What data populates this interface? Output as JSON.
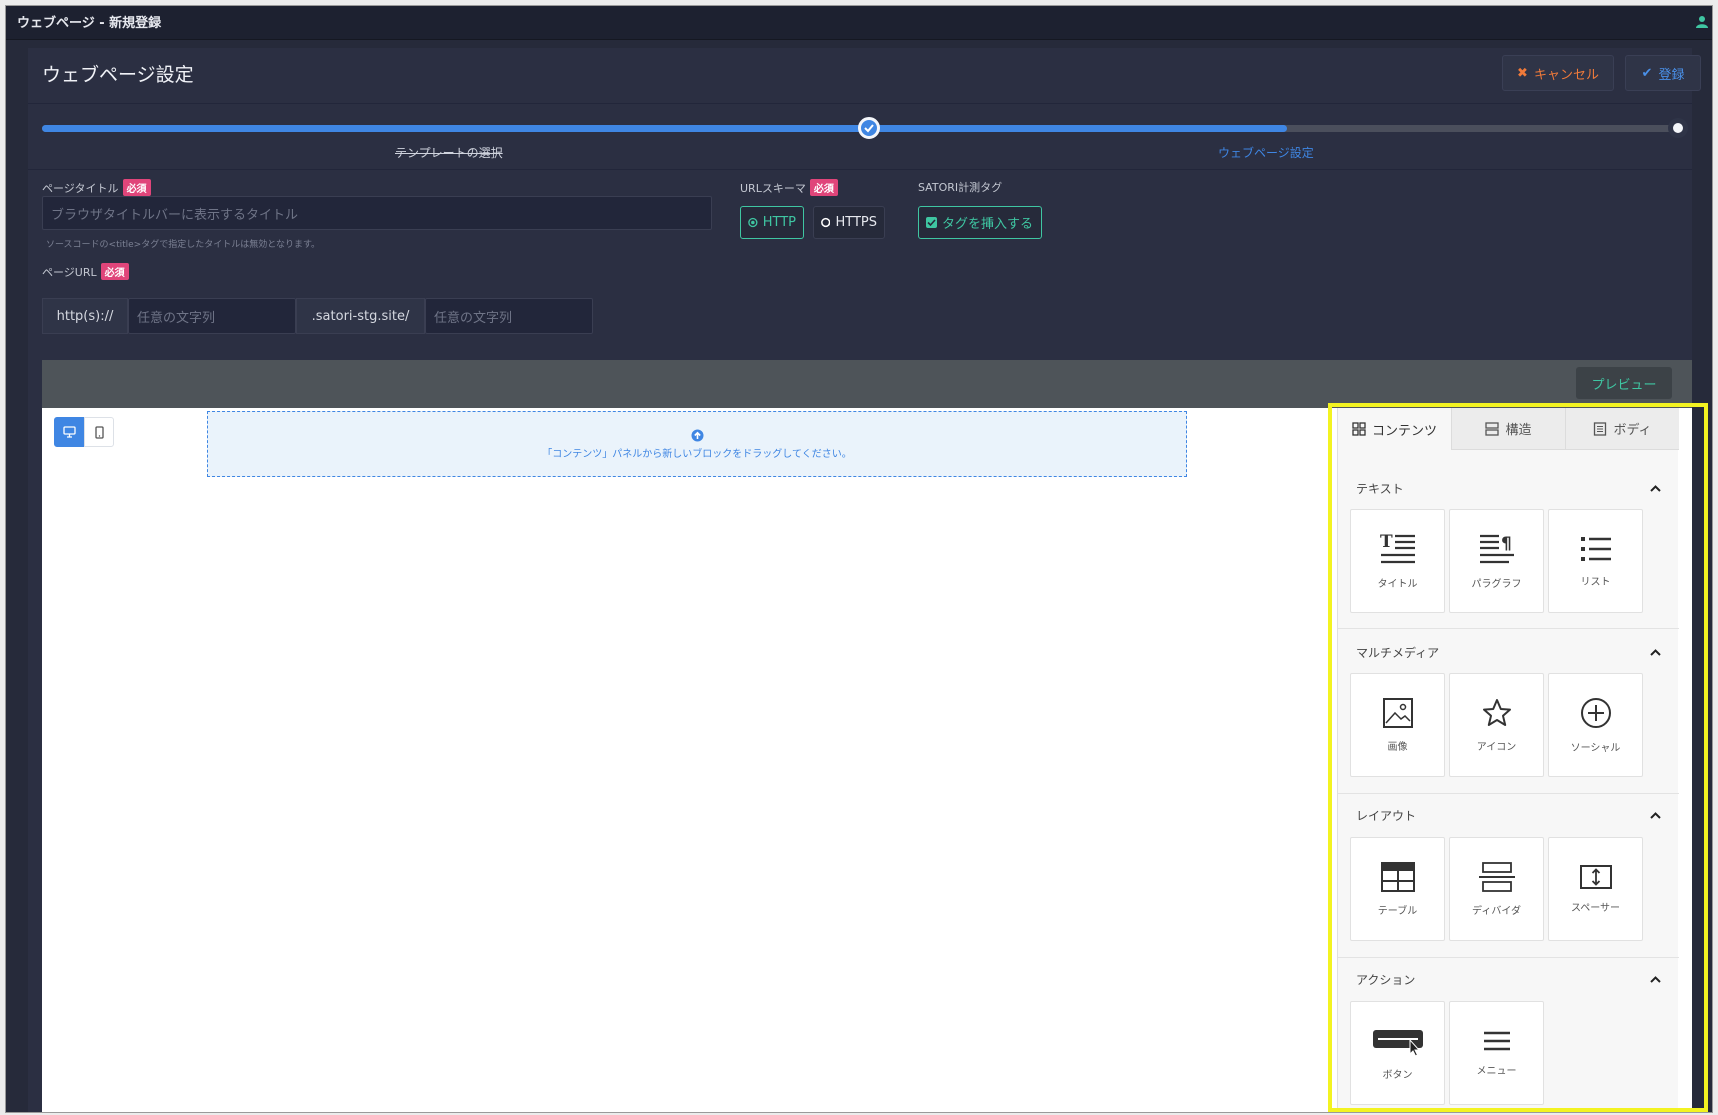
{
  "window": {
    "title": "ウェブページ - 新規登録"
  },
  "header": {
    "title": "ウェブページ設定",
    "cancel_label": "キャンセル",
    "register_label": "登録"
  },
  "progress": {
    "percent": 76,
    "steps": [
      {
        "label": "テンプレートの選択",
        "status": "completed"
      },
      {
        "label": "ウェブページ設定",
        "status": "current"
      }
    ]
  },
  "form": {
    "required_badge": "必須",
    "page_title": {
      "label": "ページタイトル",
      "placeholder": "ブラウザタイトルバーに表示するタイトル",
      "hint": "ソースコードの<title>タグで指定したタイトルは無効となります。"
    },
    "url_scheme": {
      "label": "URLスキーマ",
      "options": [
        "HTTP",
        "HTTPS"
      ],
      "selected": "HTTP"
    },
    "satori_tag": {
      "label": "SATORI計測タグ",
      "toggle_label": "タグを挿入する",
      "checked": true
    },
    "page_url": {
      "label": "ページURL",
      "prefix": "http(s)://",
      "subdomain_placeholder": "任意の文字列",
      "domain": ".satori-stg.site/",
      "path_placeholder": "任意の文字列"
    }
  },
  "editor": {
    "preview_label": "プレビュー",
    "dropzone_text": "「コンテンツ」パネルから新しいブロックをドラッグしてください。"
  },
  "side_panel": {
    "tabs": [
      {
        "label": "コンテンツ",
        "icon": "grid-icon",
        "active": true
      },
      {
        "label": "構造",
        "icon": "rows-icon",
        "active": false
      },
      {
        "label": "ボディ",
        "icon": "document-icon",
        "active": false
      }
    ],
    "sections": [
      {
        "title": "テキスト",
        "blocks": [
          {
            "label": "タイトル",
            "icon": "title-icon"
          },
          {
            "label": "パラグラフ",
            "icon": "paragraph-icon"
          },
          {
            "label": "リスト",
            "icon": "list-icon"
          }
        ]
      },
      {
        "title": "マルチメディア",
        "blocks": [
          {
            "label": "画像",
            "icon": "image-icon"
          },
          {
            "label": "アイコン",
            "icon": "star-icon"
          },
          {
            "label": "ソーシャル",
            "icon": "plus-circle-icon"
          }
        ]
      },
      {
        "title": "レイアウト",
        "blocks": [
          {
            "label": "テーブル",
            "icon": "table-icon"
          },
          {
            "label": "ディバイダ",
            "icon": "divider-icon"
          },
          {
            "label": "スペーサー",
            "icon": "spacer-icon"
          }
        ]
      },
      {
        "title": "アクション",
        "blocks": [
          {
            "label": "ボタン",
            "icon": "button-icon"
          },
          {
            "label": "メニュー",
            "icon": "menu-icon"
          }
        ]
      }
    ]
  },
  "colors": {
    "accent_blue": "#3f86e3",
    "accent_green": "#3fc6a2",
    "cancel_orange": "#f07a3a",
    "required_pink": "#e0457a",
    "highlight_yellow": "#f3f321"
  }
}
